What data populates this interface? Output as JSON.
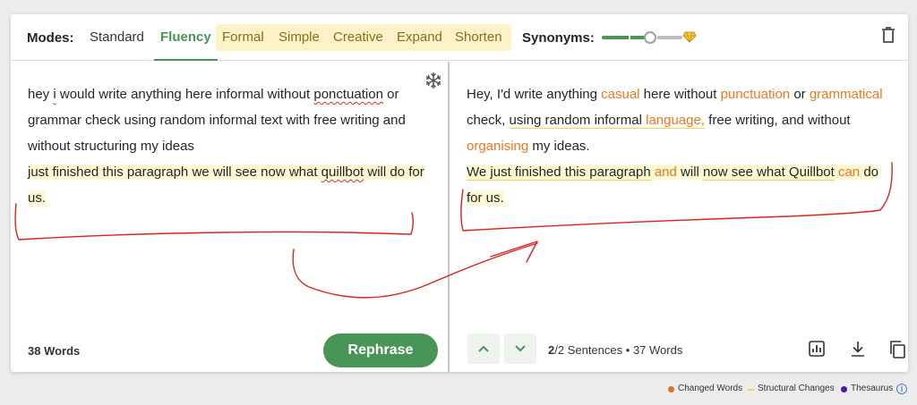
{
  "header": {
    "modes_label": "Modes:",
    "modes": [
      "Standard",
      "Fluency",
      "Formal",
      "Simple",
      "Creative",
      "Expand",
      "Shorten"
    ],
    "active_mode": "Fluency",
    "synonyms_label": "Synonyms:",
    "synonyms_level": 0.6,
    "accent_color": "#499557",
    "premium_color": "#fdf2c8"
  },
  "input": {
    "line1_a": "hey ",
    "line1_i": "i",
    "line1_b": " would write anything here informal without ",
    "ponctuation": "ponctuation",
    "line1_c": " or grammar check using random informal text with free writing and without structuring my ideas",
    "line2_a": "just finished this paragraph we will see now what ",
    "quillbot": "quillbot",
    "line2_b": " will do for us.",
    "word_count": "38 Words",
    "rephrase_label": "Rephrase"
  },
  "output": {
    "s1": [
      "Hey, I'd write anything ",
      "casual",
      " here without ",
      "punctuation",
      " or ",
      "grammatical",
      " check, ",
      "using random informal",
      " ",
      "language,",
      " free writing, and without ",
      "organising",
      " my ideas."
    ],
    "s2": [
      "We just finished this paragraph",
      " ",
      "and",
      " will ",
      "now see what Quillbot",
      " ",
      "can",
      " do for us."
    ],
    "sentences_current": "2",
    "sentences_rest": "/2 Sentences",
    "bullet": "•",
    "word_count": "37 Words",
    "changed_color": "#f0751f",
    "structural_color": "#f1d64a"
  },
  "legend": {
    "changed": "Changed Words",
    "structural": "Structural Changes",
    "thesaurus": "Thesaurus",
    "changed_color": "#e07020",
    "thesaurus_color": "#4a1aa8",
    "info": "i"
  },
  "icons": [
    "trash-icon",
    "diamond-icon",
    "freeze-icon",
    "chevron-up-icon",
    "chevron-down-icon",
    "stats-icon",
    "download-icon",
    "copy-icon",
    "info-icon"
  ]
}
